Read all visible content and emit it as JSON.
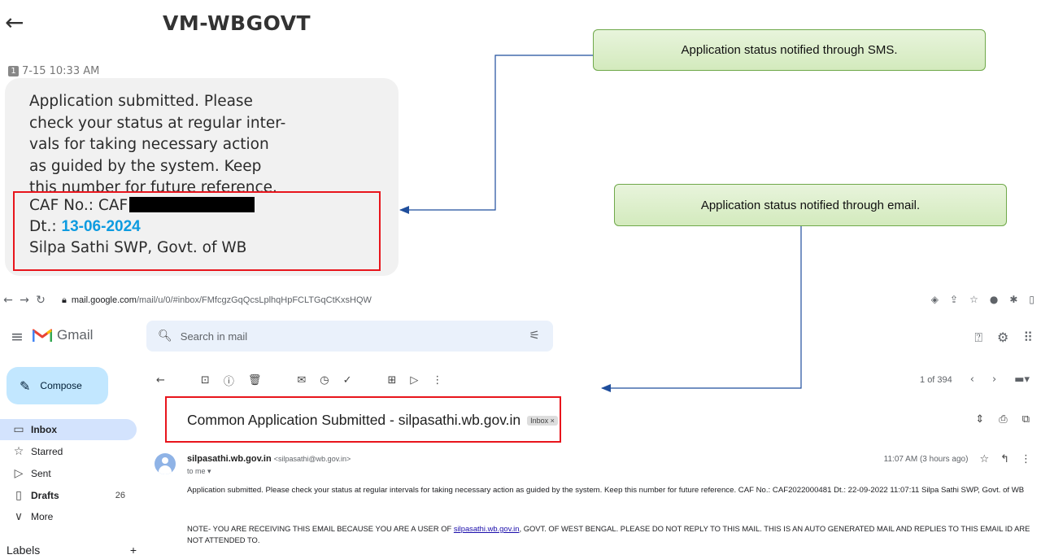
{
  "sms": {
    "back_icon": "←",
    "sender": "VM-WBGOVT",
    "sim_label": "1",
    "timestamp": "7-15 10:33 AM",
    "body": "Application submitted. Please\ncheck your status at regular inter-\nvals for taking necessary action\nas guided by the system. Keep\nthis number for future reference.",
    "caf_label": "CAF No.: CAF",
    "date_label": "Dt.:",
    "date_value": "13-06-2024",
    "signature": "Silpa Sathi SWP, Govt. of WB"
  },
  "callouts": {
    "sms": "Application status notified through SMS.",
    "email": "Application status notified through email."
  },
  "browser": {
    "url_host": "mail.google.com",
    "url_path": "/mail/u/0/#inbox/FMfcgzGqQcsLplhqHpFCLTGqCtKxsHQW"
  },
  "gmail": {
    "app_name": "Gmail",
    "search_placeholder": "Search in mail",
    "compose_label": "Compose",
    "sidebar": [
      {
        "label": "Inbox",
        "icon": "inbox-icon",
        "count": ""
      },
      {
        "label": "Starred",
        "icon": "star-icon",
        "count": ""
      },
      {
        "label": "Sent",
        "icon": "send-icon",
        "count": ""
      },
      {
        "label": "Drafts",
        "icon": "draft-icon",
        "count": "26"
      },
      {
        "label": "More",
        "icon": "chevron-down-icon",
        "count": ""
      }
    ],
    "labels_heading": "Labels",
    "pager_text": "1 of 394",
    "subject": "Common Application Submitted - silpasathi.wb.gov.in",
    "inbox_chip": "Inbox ×",
    "sender_name": "silpasathi.wb.gov.in",
    "sender_email": "<silpasathi@wb.gov.in>",
    "to_me": "to me ▾",
    "time": "11:07 AM (3 hours ago)",
    "body": "Application submitted. Please check your status at regular intervals for taking necessary action as guided by the system. Keep this number for future reference. CAF No.: CAF2022000481 Dt.: 22-09-2022 11:07:11 Silpa Sathi SWP, Govt. of WB",
    "note_before": "NOTE- YOU ARE RECEIVING THIS EMAIL BECAUSE YOU ARE A USER OF ",
    "note_link": "silpasathi.wb.gov.in",
    "note_after": ", GOVT. OF WEST BENGAL. PLEASE DO NOT REPLY TO THIS MAIL. THIS IS AN AUTO GENERATED MAIL AND REPLIES TO THIS EMAIL ID ARE NOT ATTENDED TO."
  },
  "colors": {
    "highlight": "#e8151c",
    "arrow": "#1f4e9c",
    "callout_border": "#6fa84a",
    "date_accent": "#0d9be0"
  }
}
